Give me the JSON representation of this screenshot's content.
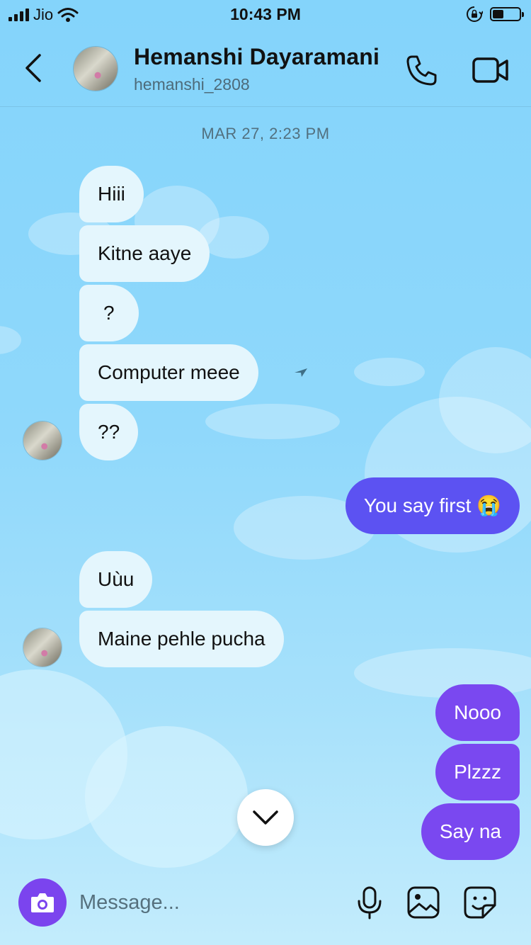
{
  "status_bar": {
    "carrier": "Jio",
    "time": "10:43 PM",
    "battery_level": 0.42
  },
  "header": {
    "name": "Hemanshi Dayaramani",
    "handle": "hemanshi_2808"
  },
  "chat": {
    "date_label": "MAR 27, 2:23 PM",
    "messages": [
      {
        "from": "them",
        "text": "Hiii"
      },
      {
        "from": "them",
        "text": "Kitne aaye"
      },
      {
        "from": "them",
        "text": "?"
      },
      {
        "from": "them",
        "text": "Computer meee"
      },
      {
        "from": "them",
        "text": "??"
      },
      {
        "from": "me",
        "text": "You say first 😭"
      },
      {
        "from": "them",
        "text": "Uùu"
      },
      {
        "from": "them",
        "text": "Maine pehle pucha"
      },
      {
        "from": "me",
        "text": "Nooo"
      },
      {
        "from": "me",
        "text": "Plzzz"
      },
      {
        "from": "me",
        "text": "Say na"
      }
    ]
  },
  "composer": {
    "placeholder": "Message..."
  },
  "colors": {
    "accent": "#7b44ee",
    "outgoing_blue": "#5c52f2",
    "outgoing_violet": "#7a48f0",
    "incoming": "#e4f6fd"
  },
  "icons": [
    "signal-icon",
    "wifi-icon",
    "rotation-lock-icon",
    "battery-icon",
    "back-chevron-icon",
    "phone-icon",
    "video-camera-icon",
    "chevron-down-icon",
    "camera-icon",
    "microphone-icon",
    "gallery-icon",
    "sticker-icon"
  ]
}
